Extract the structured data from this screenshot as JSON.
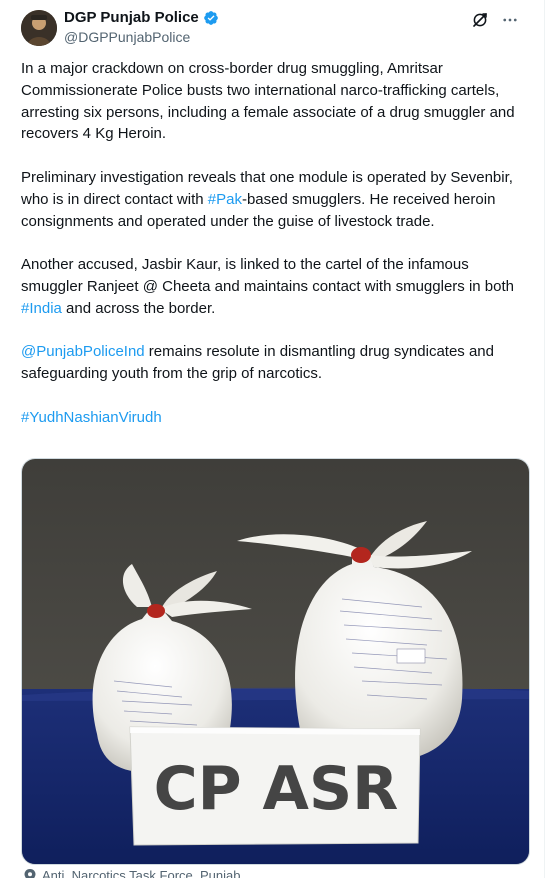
{
  "author": {
    "display_name": "DGP Punjab Police",
    "handle": "@DGPPunjabPolice"
  },
  "icons": {
    "verified": "verified-badge-icon",
    "grok": "grok-icon",
    "more": "more-icon",
    "location": "location-pin-icon"
  },
  "colors": {
    "link": "#1d9bf0",
    "verified": "#1d9bf0",
    "muted": "#536471"
  },
  "post": {
    "p1": "In a major crackdown on cross-border drug smuggling, Amritsar Commissionerate Police busts two international narco-trafficking cartels, arresting six persons, including a female associate of a drug smuggler and recovers 4 Kg Heroin.",
    "p2_a": "Preliminary investigation reveals that one module is operated by Sevenbir, who is in direct contact with ",
    "p2_link": "#Pak",
    "p2_b": "-based smugglers. He received heroin consignments and operated under the guise of livestock trade.",
    "p3_a": "Another accused, Jasbir Kaur, is linked to the cartel of the infamous smuggler Ranjeet @ Cheeta and maintains contact with smugglers in both ",
    "p3_link": "#India",
    "p3_b": " and across the border.",
    "p4_link": "@PunjabPoliceInd",
    "p4_b": " remains resolute in dismantling drug syndicates and safeguarding youth from the grip of narcotics.",
    "hashtag": "#YudhNashianVirudh"
  },
  "media": {
    "sign_text": "CP ASR"
  },
  "caption": "Anti_Narcotics Task Force, Punjab"
}
